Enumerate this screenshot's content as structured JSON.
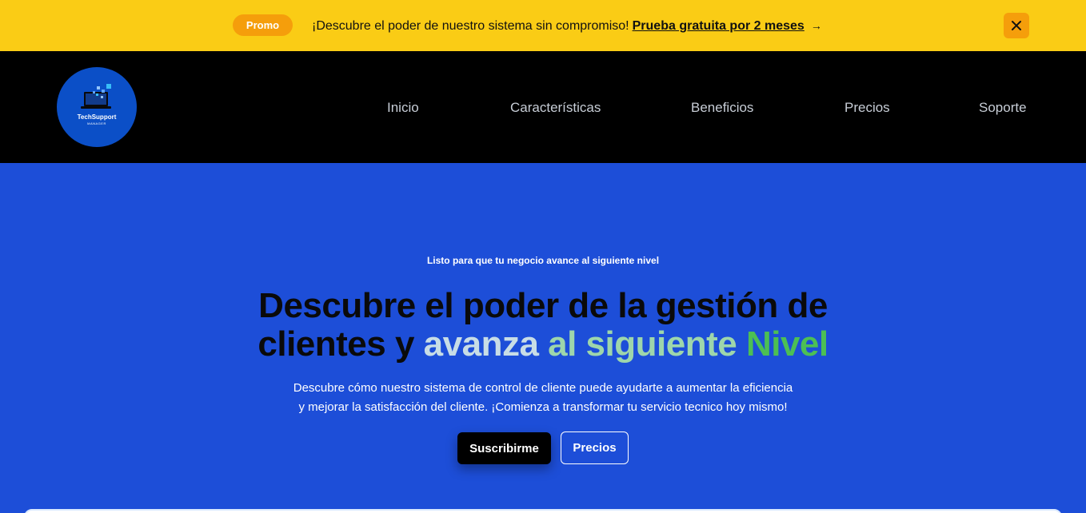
{
  "promo": {
    "badge": "Promo",
    "message": "¡Descubre el poder de nuestro sistema sin compromiso!",
    "link": "Prueba gratuita por 2 meses",
    "arrow": "→",
    "close_icon": "close-icon"
  },
  "nav": {
    "logo": {
      "title": "TechSupport",
      "subtitle": "MANAGER",
      "icon": "laptop-logo-icon"
    },
    "items": [
      {
        "label": "Inicio"
      },
      {
        "label": "Características"
      },
      {
        "label": "Beneficios"
      },
      {
        "label": "Precios"
      },
      {
        "label": "Soporte"
      }
    ]
  },
  "hero": {
    "eyebrow": "Listo para que tu negocio avance al siguiente nivel",
    "headline_line1": "Descubre el poder de la gestión de",
    "headline_line2_a": "clientes y ",
    "headline_line2_b": "avanza ",
    "headline_line2_c": "al siguiente ",
    "headline_line2_d": "Nivel",
    "description_line1": "Descubre cómo nuestro sistema de control de cliente puede ayudarte a aumentar la eficiencia",
    "description_line2": "y mejorar la satisfacción del cliente. ¡Comienza a transformar tu servicio tecnico hoy mismo!",
    "primary_button": "Suscribirme",
    "secondary_button": "Precios"
  },
  "colors": {
    "promo_bg": "#facc15",
    "promo_accent": "#f59e0b",
    "nav_bg": "#000000",
    "hero_bg": "#1d4ed8",
    "logo_bg": "#0b4fc7",
    "headline_dark": "#0a0a0a",
    "headline_light": "#c8dde6",
    "headline_mid": "#9ed6ab",
    "headline_green": "#4cbf54"
  }
}
